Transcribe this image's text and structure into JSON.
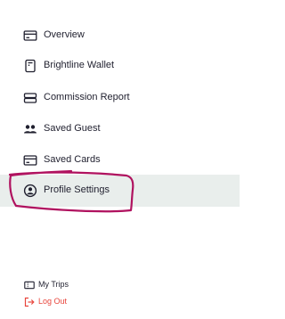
{
  "menu": {
    "items": [
      {
        "label": "Overview",
        "icon": "card-icon",
        "active": false
      },
      {
        "label": "Brightline Wallet",
        "icon": "wallet-icon",
        "active": false
      },
      {
        "label": "Commission Report",
        "icon": "report-icon",
        "active": false
      },
      {
        "label": "Saved Guest",
        "icon": "guests-icon",
        "active": false
      },
      {
        "label": "Saved Cards",
        "icon": "saved-card-icon",
        "active": false
      },
      {
        "label": "Profile Settings",
        "icon": "user-circle-icon",
        "active": true
      }
    ]
  },
  "bottom": {
    "my_trips": "My Trips",
    "log_out": "Log Out"
  },
  "colors": {
    "text": "#1f1f2e",
    "active_bg": "#e9eeec",
    "logout": "#e8453c",
    "annotation": "#b0125f"
  }
}
